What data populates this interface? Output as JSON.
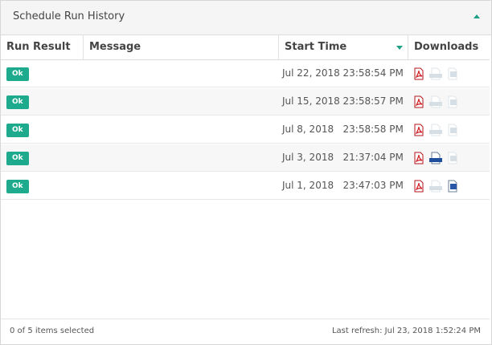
{
  "panel": {
    "title": "Schedule Run History",
    "accent": "#1ea187"
  },
  "columns": {
    "result": "Run Result",
    "message": "Message",
    "start_time": "Start Time",
    "downloads": "Downloads"
  },
  "rows": [
    {
      "result": "Ok",
      "message": "",
      "start_time": "Jul 22, 2018 23:58:54 PM",
      "pdf": true,
      "html": false,
      "doc": false
    },
    {
      "result": "Ok",
      "message": "",
      "start_time": "Jul 15, 2018 23:58:57 PM",
      "pdf": true,
      "html": false,
      "doc": false
    },
    {
      "result": "Ok",
      "message": "",
      "start_time": "Jul 8, 2018   23:58:58 PM",
      "pdf": true,
      "html": false,
      "doc": false
    },
    {
      "result": "Ok",
      "message": "",
      "start_time": "Jul 3, 2018   21:37:04 PM",
      "pdf": true,
      "html": true,
      "doc": false
    },
    {
      "result": "Ok",
      "message": "",
      "start_time": "Jul 1, 2018   23:47:03 PM",
      "pdf": true,
      "html": false,
      "doc": true
    }
  ],
  "footer": {
    "selected": "0 of 5 items selected",
    "last_refresh": "Last refresh: Jul 23, 2018 1:52:24 PM"
  }
}
